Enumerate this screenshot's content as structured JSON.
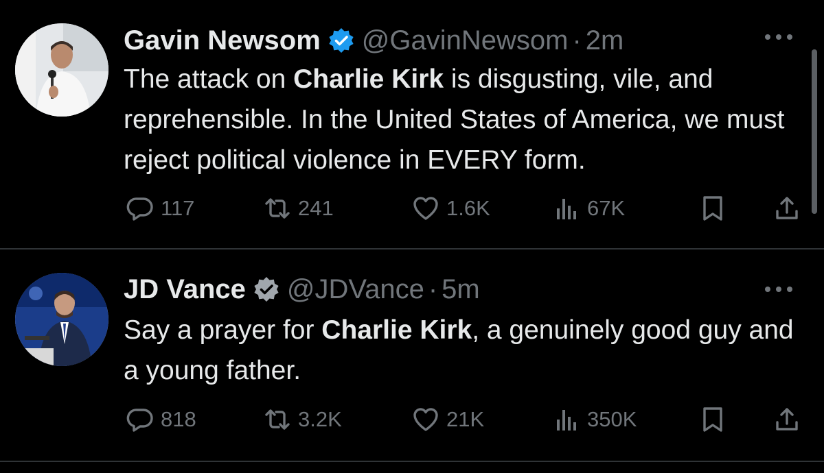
{
  "tweets": [
    {
      "name": "Gavin Newsom",
      "handle": "@GavinNewsom",
      "separator": "·",
      "time": "2m",
      "text_segments": [
        {
          "text": "The attack on ",
          "bold": false
        },
        {
          "text": "Charlie Kirk",
          "bold": true
        },
        {
          "text": " is disgusting, vile, and reprehensible. In the United States of America, we must reject political violence in EVERY form.",
          "bold": false
        }
      ],
      "stats": {
        "replies": "117",
        "reposts": "241",
        "likes": "1.6K",
        "views": "67K"
      }
    },
    {
      "name": "JD Vance",
      "handle": "@JDVance",
      "separator": "·",
      "time": "5m",
      "text_segments": [
        {
          "text": "Say a prayer for ",
          "bold": false
        },
        {
          "text": "Charlie Kirk",
          "bold": true
        },
        {
          "text": ", a genuinely good guy and a young father.",
          "bold": false
        }
      ],
      "stats": {
        "replies": "818",
        "reposts": "3.2K",
        "likes": "21K",
        "views": "350K"
      }
    }
  ],
  "icons": {
    "verified": "verified-badge-icon",
    "more": "more-icon",
    "reply": "reply-icon",
    "repost": "repost-icon",
    "like": "like-icon",
    "views": "views-icon",
    "bookmark": "bookmark-icon",
    "share": "share-icon"
  },
  "colors": {
    "background": "#000000",
    "text": "#e7e9ea",
    "muted": "#71767b",
    "verified": "#1d9bf0",
    "divider": "#2f3336"
  }
}
